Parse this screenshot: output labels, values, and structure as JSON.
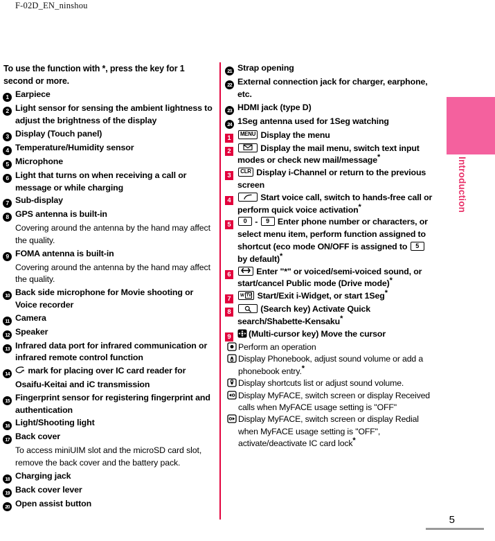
{
  "header": {
    "running_head": "F-02D_EN_ninshou"
  },
  "side_tab": {
    "label": "Introduction",
    "tab_color": "#F4619E",
    "label_color": "#E8336A"
  },
  "footer": {
    "page_number": "5"
  },
  "divider_color": "#E2003C",
  "lead": {
    "text_before_star": "To use the function with ",
    "star": "*",
    "text_after_star": ", press the key for 1 second or more."
  },
  "left_column": [
    {
      "num": "1",
      "title": "Earpiece"
    },
    {
      "num": "2",
      "title": "Light sensor for sensing the ambient lightness to adjust the brightness of the display"
    },
    {
      "num": "3",
      "title": "Display (Touch panel)"
    },
    {
      "num": "4",
      "title": "Temperature/Humidity sensor"
    },
    {
      "num": "5",
      "title": "Microphone"
    },
    {
      "num": "6",
      "title": "Light that turns on when receiving a call or message or while charging"
    },
    {
      "num": "7",
      "title": "Sub-display"
    },
    {
      "num": "8",
      "title": "GPS antenna is built-in",
      "note": "Covering around the antenna by the hand may affect the quality."
    },
    {
      "num": "9",
      "title": "FOMA antenna is built-in",
      "note": "Covering around the antenna by the hand may affect the quality."
    },
    {
      "num": "10",
      "title": "Back side microphone for Movie shooting or Voice recorder"
    },
    {
      "num": "11",
      "title": "Camera"
    },
    {
      "num": "12",
      "title": "Speaker"
    },
    {
      "num": "13",
      "title": "Infrared data port for infrared communication or infrared remote control function"
    },
    {
      "num": "14",
      "icon": "ic-mark-icon",
      "title": " mark for placing over IC card reader for Osaifu-Keitai and iC transmission"
    },
    {
      "num": "15",
      "title": "Fingerprint sensor for registering fingerprint and authentication"
    },
    {
      "num": "16",
      "title": "Light/Shooting light"
    },
    {
      "num": "17",
      "title": "Back cover",
      "note": "To access miniUIM slot and the microSD card slot, remove the back cover and the battery pack."
    },
    {
      "num": "18",
      "title": "Charging jack"
    },
    {
      "num": "19",
      "title": "Back cover lever"
    },
    {
      "num": "20",
      "title": "Open assist button"
    }
  ],
  "right_column_circled": [
    {
      "num": "21",
      "title": "Strap opening"
    },
    {
      "num": "22",
      "title": "External connection jack for charger, earphone, etc."
    },
    {
      "num": "23",
      "title": "HDMI jack (type D)"
    },
    {
      "num": "24",
      "title": "1Seg antenna used for 1Seg watching"
    }
  ],
  "key_list": [
    {
      "num": "1",
      "key_glyph": "MENU",
      "key_type": "text",
      "text": "Display the menu",
      "starred": false
    },
    {
      "num": "2",
      "key_glyph": "mail-envelope-icon",
      "key_type": "icon",
      "text": "Display the mail menu, switch text input modes or check new mail/message",
      "starred": true
    },
    {
      "num": "3",
      "key_glyph": "CLR",
      "key_type": "text",
      "text": "Display i-Channel or return to the previous screen",
      "starred": false
    },
    {
      "num": "4",
      "key_glyph": "call-handset-icon",
      "key_type": "icon",
      "text": "Start voice call, switch to hands-free call or perform quick voice activation",
      "starred": true
    },
    {
      "num": "5",
      "key_glyph_range": [
        "0",
        "9"
      ],
      "key_type": "range",
      "text_part1": "Enter phone number or characters, or select menu item, perform function assigned to shortcut (eco mode ON/OFF is assigned to ",
      "inline_key": "5",
      "text_part2": " by default)",
      "starred": true
    },
    {
      "num": "6",
      "key_glyph": "asterisk-key-icon",
      "key_type": "icon",
      "text": "Enter \"*\" or voiced/semi-voiced sound, or start/cancel Public mode (Drive mode)",
      "starred": true
    },
    {
      "num": "7",
      "key_glyph": "i-widget-tv-icon",
      "key_type": "icon",
      "text": "Start/Exit i-Widget, or start 1Seg",
      "starred": true
    },
    {
      "num": "8",
      "key_glyph": "search-magnifier-icon",
      "key_type": "icon",
      "text": "(Search key) Activate Quick search/Shabette-Kensaku",
      "starred": true
    },
    {
      "num": "9",
      "key_glyph": "multi-cursor-key-icon",
      "key_type": "icon",
      "text": "(Multi-cursor key) Move the cursor",
      "starred": false,
      "sub_items": [
        {
          "icon": "center-select-key-icon",
          "text": "Perform an operation",
          "starred": false
        },
        {
          "icon": "up-cursor-key-icon",
          "text": "Display Phonebook, adjust sound volume or add a phonebook entry.",
          "starred": true
        },
        {
          "icon": "down-cursor-key-icon",
          "text": "Display shortcuts list or adjust sound volume.",
          "starred": false
        },
        {
          "icon": "left-cursor-key-icon",
          "text": "Display MyFACE, switch screen or display Received calls when MyFACE usage setting is \"OFF\"",
          "starred": false
        },
        {
          "icon": "right-cursor-key-icon",
          "text": "Display MyFACE, switch screen or display Redial when MyFACE usage setting is \"OFF\", activate/deactivate IC card lock",
          "starred": true
        }
      ]
    }
  ]
}
